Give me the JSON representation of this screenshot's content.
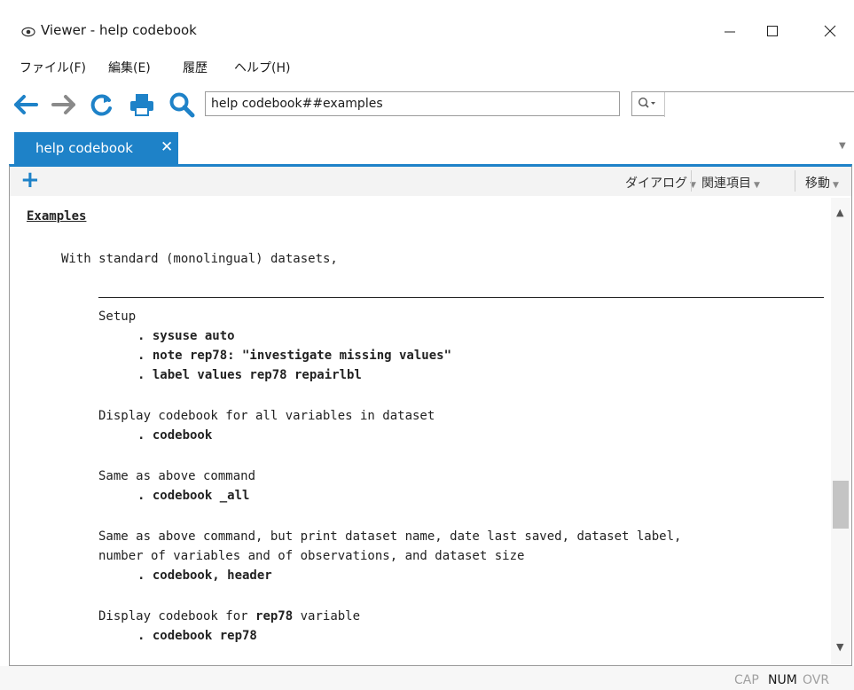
{
  "window": {
    "title": "Viewer - help codebook",
    "icon": "eye-icon",
    "controls": [
      "minimize-icon",
      "maximize-icon",
      "close-icon"
    ]
  },
  "menu": {
    "file": "ファイル(F)",
    "edit": "編集(E)",
    "history": "履歴",
    "help": "ヘルプ(H)"
  },
  "toolbar": {
    "icons": [
      "back-arrow-icon",
      "forward-arrow-icon",
      "refresh-icon",
      "print-icon",
      "search-icon"
    ],
    "url_value": "help codebook##examples",
    "find_icon": "find-magnifier-icon",
    "find_value": ""
  },
  "tabs": [
    {
      "label": "help codebook",
      "close": "✕",
      "active": true
    }
  ],
  "viewer_toolbar": {
    "dialog": "ダイアログ",
    "related": "関連項目",
    "jump": "移動"
  },
  "content": {
    "header": "Examples",
    "intro": "With standard (monolingual) datasets,",
    "setup_label": "Setup",
    "setup_cmd1": ". sysuse auto",
    "setup_cmd2": ". note rep78: \"investigate missing values\"",
    "setup_cmd3": ". label values rep78 repairlbl",
    "ex1_desc": "Display codebook for all variables in dataset",
    "ex1_cmd": ". codebook",
    "ex2_desc": "Same as above command",
    "ex2_cmd": ". codebook _all",
    "ex3_desc1": "Same as above command, but print dataset name, date last saved, dataset label,",
    "ex3_desc2": "number of variables and of observations, and dataset size",
    "ex3_cmd": ". codebook, header",
    "ex4_desc_a": "Display codebook for ",
    "ex4_desc_var": "rep78",
    "ex4_desc_b": " variable",
    "ex4_cmd": ". codebook rep78"
  },
  "status": {
    "cap": "CAP",
    "num": "NUM",
    "ovr": "OVR"
  },
  "colors": {
    "accent": "#1e82c8"
  }
}
